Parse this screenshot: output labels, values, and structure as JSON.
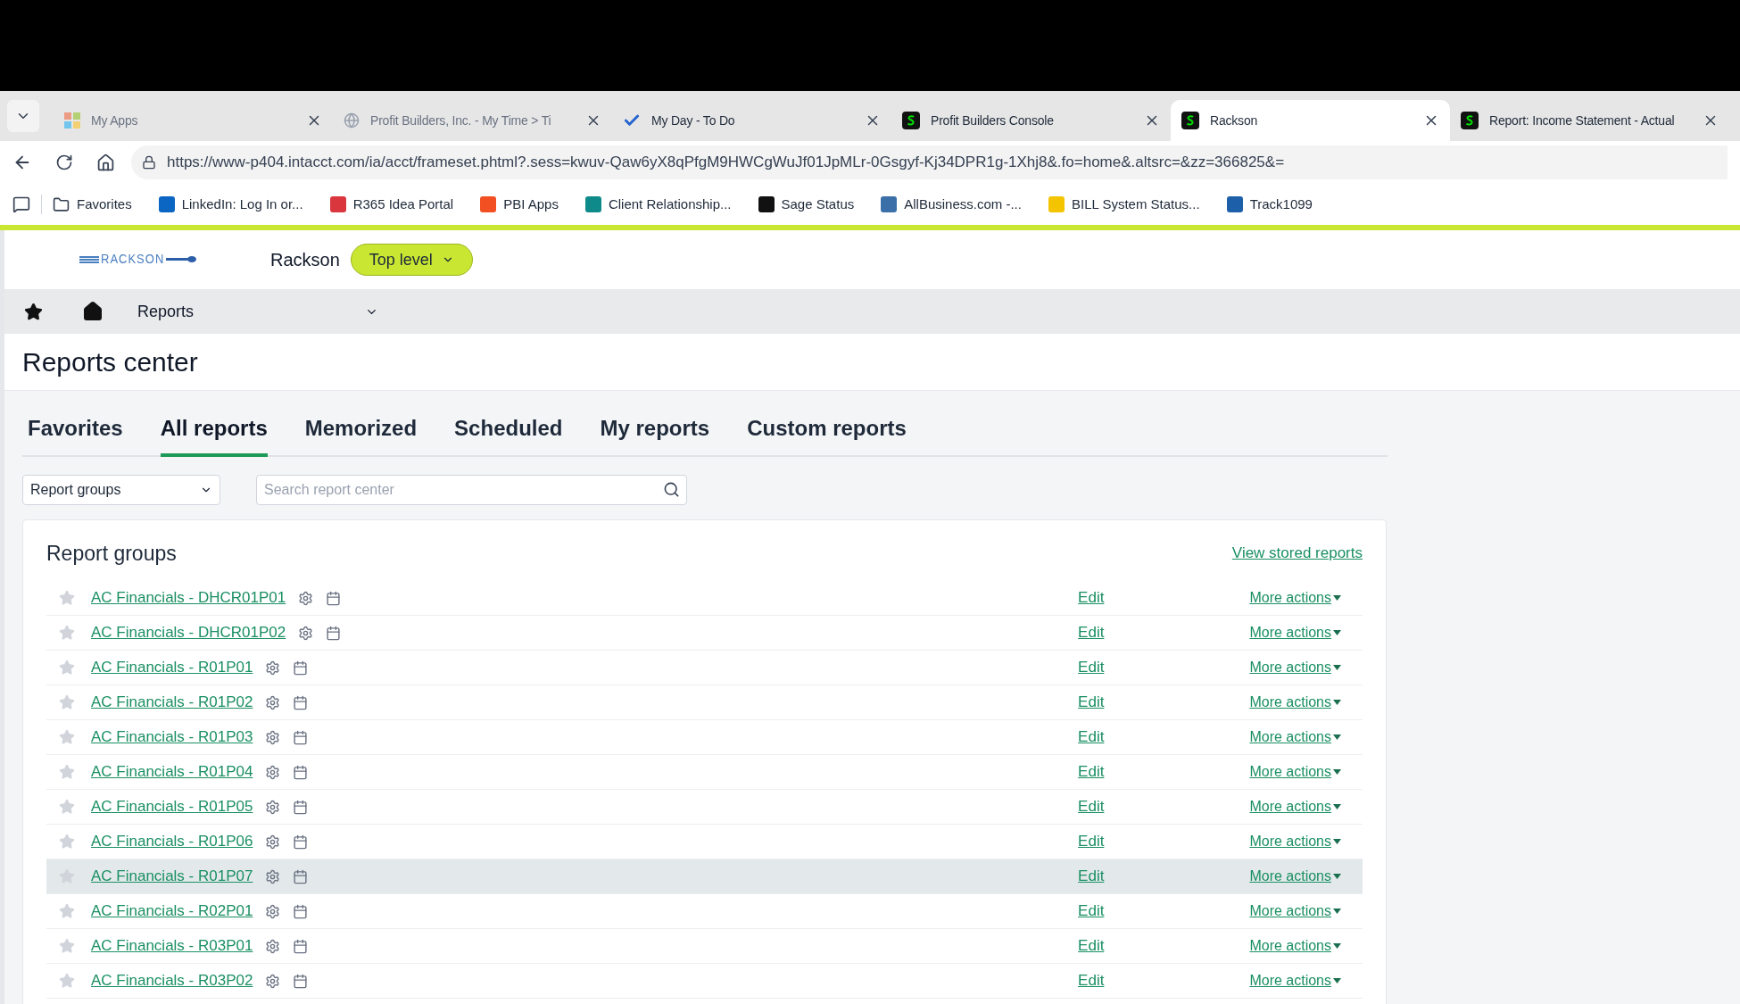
{
  "browser": {
    "tabs": [
      {
        "title": "My Apps",
        "kind": "apps",
        "selected": false
      },
      {
        "title": "Profit Builders, Inc. - My Time > Ti",
        "kind": "globe",
        "selected": false
      },
      {
        "title": "My Day - To Do",
        "kind": "check",
        "selected": false
      },
      {
        "title": "Profit Builders Console",
        "kind": "sage",
        "selected": false
      },
      {
        "title": "Rackson",
        "kind": "sage",
        "selected": true
      },
      {
        "title": "Report: Income Statement - Actual",
        "kind": "sage",
        "selected": false
      }
    ],
    "address": "https://www-p404.intacct.com/ia/acct/frameset.phtml?.sess=kwuv-Qaw6yX8qPfgM9HWCgWuJf01JpMLr-0Gsgyf-Kj34DPR1g-1Xhj8&.fo=home&.altsrc=&zz=366825&=",
    "bookmarks": [
      {
        "label": "Favorites",
        "kind": "folder"
      },
      {
        "label": "LinkedIn: Log In or...",
        "kind": "site",
        "color": "#0a66c2"
      },
      {
        "label": "R365 Idea Portal",
        "kind": "site",
        "color": "#d9363e"
      },
      {
        "label": "PBI Apps",
        "kind": "site",
        "color": "#f25022"
      },
      {
        "label": "Client Relationship...",
        "kind": "site",
        "color": "#0f8a8a"
      },
      {
        "label": "Sage Status",
        "kind": "site",
        "color": "#111111"
      },
      {
        "label": "AllBusiness.com -...",
        "kind": "site",
        "color": "#3b6fa8"
      },
      {
        "label": "BILL System Status...",
        "kind": "site",
        "color": "#f5c400"
      },
      {
        "label": "Track1099",
        "kind": "site",
        "color": "#1d5fa8"
      }
    ]
  },
  "header": {
    "logo": "RACKSON",
    "company": "Rackson",
    "entity": "Top level"
  },
  "nav": {
    "section": "Reports"
  },
  "page_title": "Reports center",
  "report_tabs": [
    {
      "label": "Favorites",
      "selected": false
    },
    {
      "label": "All reports",
      "selected": true
    },
    {
      "label": "Memorized",
      "selected": false
    },
    {
      "label": "Scheduled",
      "selected": false
    },
    {
      "label": "My reports",
      "selected": false
    },
    {
      "label": "Custom reports",
      "selected": false
    }
  ],
  "filter": {
    "value": "Report groups"
  },
  "search": {
    "placeholder": "Search report center"
  },
  "card": {
    "title": "Report groups",
    "link": "View stored reports",
    "rows": [
      {
        "name": "AC Financials - DHCR01P01",
        "favorite": false,
        "highlighted": false,
        "edit": "Edit",
        "more": "More actions"
      },
      {
        "name": "AC Financials - DHCR01P02",
        "favorite": false,
        "highlighted": false,
        "edit": "Edit",
        "more": "More actions"
      },
      {
        "name": "AC Financials - R01P01",
        "favorite": false,
        "highlighted": false,
        "edit": "Edit",
        "more": "More actions"
      },
      {
        "name": "AC Financials - R01P02",
        "favorite": false,
        "highlighted": false,
        "edit": "Edit",
        "more": "More actions"
      },
      {
        "name": "AC Financials - R01P03",
        "favorite": false,
        "highlighted": false,
        "edit": "Edit",
        "more": "More actions"
      },
      {
        "name": "AC Financials - R01P04",
        "favorite": false,
        "highlighted": false,
        "edit": "Edit",
        "more": "More actions"
      },
      {
        "name": "AC Financials - R01P05",
        "favorite": false,
        "highlighted": false,
        "edit": "Edit",
        "more": "More actions"
      },
      {
        "name": "AC Financials - R01P06",
        "favorite": false,
        "highlighted": false,
        "edit": "Edit",
        "more": "More actions"
      },
      {
        "name": "AC Financials - R01P07",
        "favorite": false,
        "highlighted": true,
        "edit": "Edit",
        "more": "More actions"
      },
      {
        "name": "AC Financials - R02P01",
        "favorite": false,
        "highlighted": false,
        "edit": "Edit",
        "more": "More actions"
      },
      {
        "name": "AC Financials - R03P01",
        "favorite": false,
        "highlighted": false,
        "edit": "Edit",
        "more": "More actions"
      },
      {
        "name": "AC Financials - R03P02",
        "favorite": false,
        "highlighted": false,
        "edit": "Edit",
        "more": "More actions"
      }
    ]
  }
}
